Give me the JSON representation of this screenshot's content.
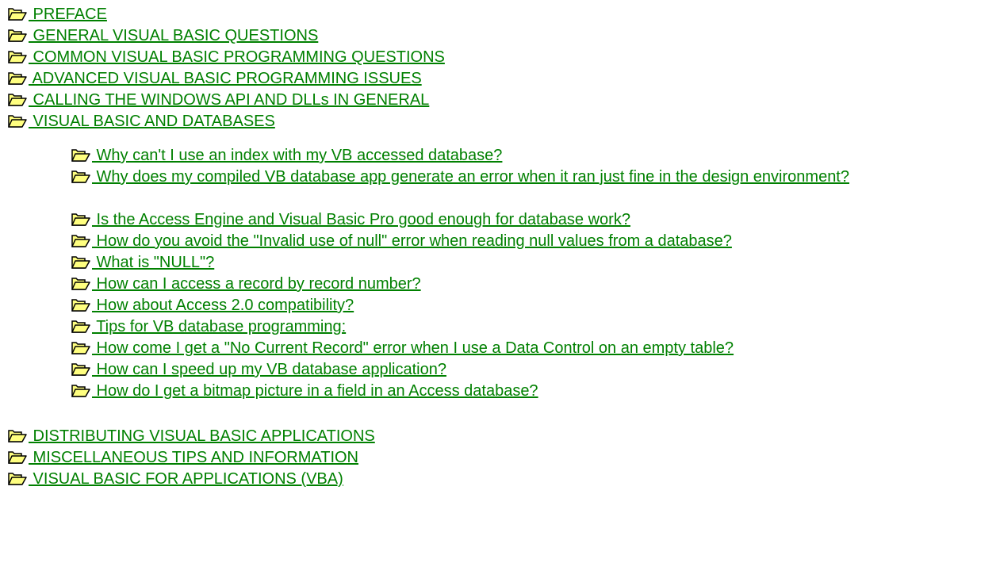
{
  "colors": {
    "link": "#008000",
    "folder_fill": "#ffff80",
    "folder_outline": "#000000",
    "background": "#ffffff"
  },
  "icon": "open-folder-icon",
  "sections_top": [
    {
      "label": " PREFACE"
    },
    {
      "label": " GENERAL VISUAL BASIC QUESTIONS"
    },
    {
      "label": " COMMON VISUAL BASIC PROGRAMMING QUESTIONS"
    },
    {
      "label": " ADVANCED VISUAL BASIC PROGRAMMING ISSUES"
    },
    {
      "label": " CALLING THE WINDOWS API AND DLLs IN GENERAL"
    },
    {
      "label": " VISUAL BASIC AND DATABASES"
    }
  ],
  "database_topics": [
    {
      "label": " Why can't I use an index with my VB accessed database?"
    },
    {
      "label": " Why does my compiled VB database app generate an error when it ran just fine in the design environment?"
    },
    {
      "label": " Is the Access Engine and Visual Basic Pro good enough for database work?"
    },
    {
      "label": " How do you avoid the \"Invalid use of null\" error when reading null values from a database?"
    },
    {
      "label": " What is \"NULL\"?"
    },
    {
      "label": " How can I access a record by record number?"
    },
    {
      "label": " How about Access 2.0 compatibility?"
    },
    {
      "label": " Tips for VB database programming:"
    },
    {
      "label": " How come I get a \"No Current Record\" error when I use a Data Control on an empty table?"
    },
    {
      "label": " How can I speed up my VB database application?"
    },
    {
      "label": " How do I get a bitmap picture in a field in an Access database?"
    }
  ],
  "sections_bottom": [
    {
      "label": " DISTRIBUTING VISUAL BASIC APPLICATIONS"
    },
    {
      "label": " MISCELLANEOUS TIPS AND INFORMATION"
    },
    {
      "label": " VISUAL BASIC FOR APPLICATIONS (VBA)"
    }
  ]
}
